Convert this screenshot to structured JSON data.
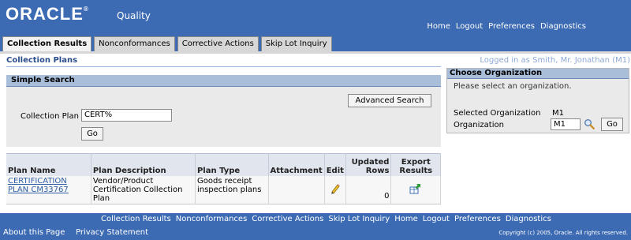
{
  "header": {
    "logo": "ORACLE",
    "logo_mark": "®",
    "app_name": "Quality",
    "global_links": [
      "Home",
      "Logout",
      "Preferences",
      "Diagnostics"
    ]
  },
  "tabs": [
    {
      "label": "Collection Results",
      "active": true
    },
    {
      "label": "Nonconformances",
      "active": false
    },
    {
      "label": "Corrective Actions",
      "active": false
    },
    {
      "label": "Skip Lot Inquiry",
      "active": false
    }
  ],
  "page": {
    "title": "Collection Plans",
    "logged_in_prefix": "Logged in as",
    "user": "Smith, Mr. Jonathan (M1)"
  },
  "search": {
    "header": "Simple Search",
    "advanced_label": "Advanced Search",
    "plan_label": "Collection Plan",
    "plan_value": "CERT%",
    "go_label": "Go"
  },
  "table": {
    "columns": [
      "Plan Name",
      "Plan Description",
      "Plan Type",
      "Attachment",
      "Edit",
      "Updated Rows",
      "Export Results"
    ],
    "rows": [
      {
        "plan_name": "CERTIFICATION PLAN CM33767",
        "description": "Vendor/Product Certification Collection Plan",
        "plan_type": "Goods receipt inspection plans",
        "attachment": "",
        "edit_icon": "pencil-icon",
        "updated_rows": "0",
        "export_icon": "export-icon"
      }
    ]
  },
  "organization": {
    "header": "Choose Organization",
    "message": "Please select an organization.",
    "selected_label": "Selected Organization",
    "selected_value": "M1",
    "org_label": "Organization",
    "org_value": "M1",
    "go_label": "Go"
  },
  "footer": {
    "links": [
      "Collection Results",
      "Nonconformances",
      "Corrective Actions",
      "Skip Lot Inquiry",
      "Home",
      "Logout",
      "Preferences",
      "Diagnostics"
    ],
    "about": "About this Page",
    "privacy": "Privacy Statement",
    "copyright": "Copyright (c) 2005, Oracle. All rights reserved."
  },
  "colors": {
    "brand_blue": "#3c6bb4",
    "header_band": "#a9bed9",
    "link": "#2f5ea6"
  }
}
